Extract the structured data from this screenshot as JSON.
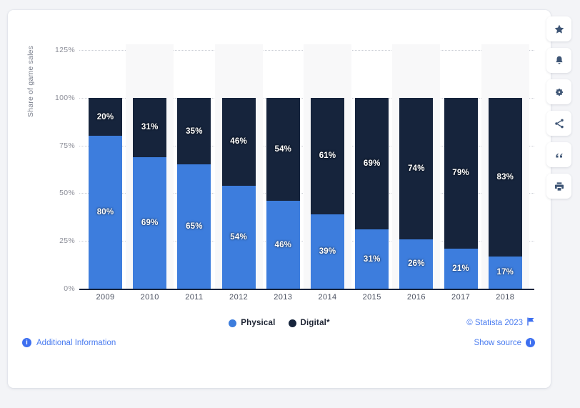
{
  "chart_data": {
    "type": "bar",
    "subtype": "stacked-percent",
    "title": "",
    "xlabel": "",
    "ylabel": "Share of game sales",
    "ylim": [
      0,
      125
    ],
    "yticks": [
      "0%",
      "25%",
      "50%",
      "75%",
      "100%",
      "125%"
    ],
    "ytick_values": [
      0,
      25,
      50,
      75,
      100,
      125
    ],
    "grid": true,
    "legend_position": "bottom",
    "categories": [
      "2009",
      "2010",
      "2011",
      "2012",
      "2013",
      "2014",
      "2015",
      "2016",
      "2017",
      "2018"
    ],
    "series": [
      {
        "name": "Physical",
        "color": "#3d7ddd",
        "values": [
          80,
          69,
          65,
          54,
          46,
          39,
          31,
          26,
          21,
          17
        ],
        "labels": [
          "80%",
          "69%",
          "65%",
          "54%",
          "46%",
          "39%",
          "31%",
          "26%",
          "21%",
          "17%"
        ]
      },
      {
        "name": "Digital*",
        "color": "#16243c",
        "values": [
          20,
          31,
          35,
          46,
          54,
          61,
          69,
          74,
          79,
          83
        ],
        "labels": [
          "20%",
          "31%",
          "35%",
          "46%",
          "54%",
          "61%",
          "69%",
          "74%",
          "79%",
          "83%"
        ]
      }
    ]
  },
  "legend": [
    {
      "label": "Physical",
      "color": "#3d7ddd"
    },
    {
      "label": "Digital*",
      "color": "#16243c"
    }
  ],
  "footer": {
    "additional_information": "Additional Information",
    "copyright": "© Statista 2023",
    "show_source": "Show source",
    "info_glyph": "i"
  },
  "rail": [
    {
      "name": "favorite-star-icon",
      "tooltip": "star"
    },
    {
      "name": "notification-bell-icon",
      "tooltip": "bell"
    },
    {
      "name": "settings-gear-icon",
      "tooltip": "gear"
    },
    {
      "name": "share-icon",
      "tooltip": "share"
    },
    {
      "name": "citation-quote-icon",
      "tooltip": "quote"
    },
    {
      "name": "print-icon",
      "tooltip": "print"
    }
  ],
  "colors": {
    "physical": "#3d7ddd",
    "digital": "#16243c",
    "link": "#4a7cf0",
    "page_background": "#f3f4f7",
    "card_background": "#ffffff",
    "band": "#f8f8f9"
  }
}
